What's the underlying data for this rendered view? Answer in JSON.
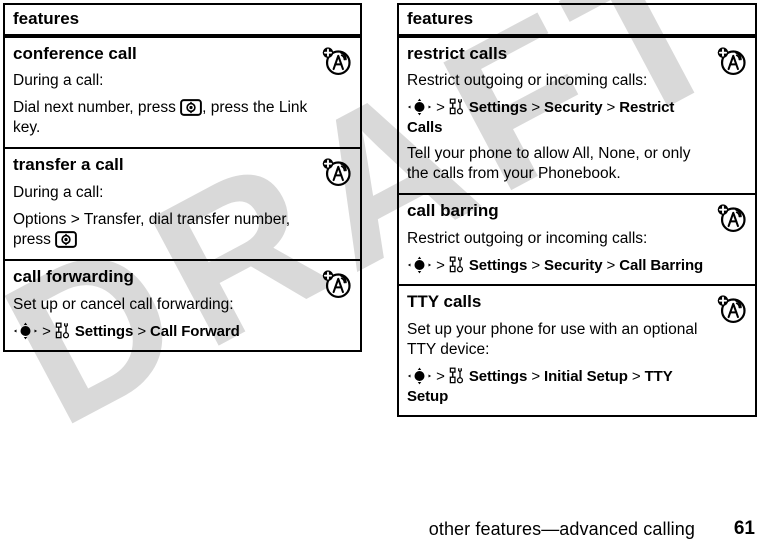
{
  "watermark": {
    "text": "DRAFT"
  },
  "footer": {
    "title": "other features—advanced calling",
    "page_number": "61"
  },
  "icons": {
    "row_badge": "tty-teletype-icon",
    "send_key": "send-key-icon",
    "nav_key": "navigation-key-icon",
    "settings_menu": "settings-tools-icon"
  },
  "colors": {
    "ink": "#000000",
    "paper": "#ffffff",
    "watermark": "#d9d9d9"
  },
  "left_table": {
    "header": "features",
    "rows": [
      {
        "title": "conference call",
        "lines": [
          {
            "kind": "text",
            "parts": [
              {
                "t": "During a call:",
                "b": false
              }
            ]
          },
          {
            "kind": "text",
            "parts": [
              {
                "t": "Dial next number, press ",
                "b": false
              },
              {
                "t": "[send-key-icon]",
                "b": false,
                "icon": "send_key"
              },
              {
                "t": ", press the ",
                "b": false
              },
              {
                "t": "Link",
                "b": true
              },
              {
                "t": " key.",
                "b": false
              }
            ]
          }
        ]
      },
      {
        "title": "transfer a call",
        "lines": [
          {
            "kind": "text",
            "parts": [
              {
                "t": "During a call:",
                "b": false
              }
            ]
          },
          {
            "kind": "text",
            "parts": [
              {
                "t": "Options",
                "b": true
              },
              {
                "t": " > ",
                "b": false
              },
              {
                "t": "Transfer",
                "b": true
              },
              {
                "t": ", dial transfer number, press ",
                "b": false
              },
              {
                "t": "[send-key-icon]",
                "b": false,
                "icon": "send_key"
              }
            ]
          }
        ]
      },
      {
        "title": "call forwarding",
        "lines": [
          {
            "kind": "text",
            "parts": [
              {
                "t": "Set up or cancel call forwarding:",
                "b": false
              }
            ]
          },
          {
            "kind": "path",
            "parts": [
              {
                "t": "[navigation-key-icon]",
                "b": false,
                "icon": "nav_key"
              },
              {
                "t": " > ",
                "b": false,
                "sep": true
              },
              {
                "t": "[settings-tools-icon]",
                "b": false,
                "icon": "settings_menu"
              },
              {
                "t": " Settings",
                "b": true
              },
              {
                "t": " > ",
                "b": false,
                "sep": true
              },
              {
                "t": "Call Forward",
                "b": true
              }
            ]
          }
        ]
      }
    ]
  },
  "right_table": {
    "header": "features",
    "rows": [
      {
        "title": "restrict calls",
        "lines": [
          {
            "kind": "text",
            "parts": [
              {
                "t": "Restrict outgoing or incoming calls:",
                "b": false
              }
            ]
          },
          {
            "kind": "path",
            "parts": [
              {
                "t": "[navigation-key-icon]",
                "b": false,
                "icon": "nav_key"
              },
              {
                "t": " > ",
                "b": false,
                "sep": true
              },
              {
                "t": "[settings-tools-icon]",
                "b": false,
                "icon": "settings_menu"
              },
              {
                "t": " Settings",
                "b": true
              },
              {
                "t": " > ",
                "b": false,
                "sep": true
              },
              {
                "t": "Security",
                "b": true
              },
              {
                "t": " > ",
                "b": false,
                "sep": true
              },
              {
                "t": "Restrict Calls",
                "b": true
              }
            ]
          },
          {
            "kind": "text",
            "parts": [
              {
                "t": "Tell your phone to allow ",
                "b": false
              },
              {
                "t": "All",
                "b": true
              },
              {
                "t": ", ",
                "b": false
              },
              {
                "t": "None",
                "b": true
              },
              {
                "t": ", or only the calls from your ",
                "b": false
              },
              {
                "t": "Phonebook",
                "b": true
              },
              {
                "t": ".",
                "b": false
              }
            ]
          }
        ]
      },
      {
        "title": "call barring",
        "lines": [
          {
            "kind": "text",
            "parts": [
              {
                "t": "Restrict outgoing or incoming calls:",
                "b": false
              }
            ]
          },
          {
            "kind": "path",
            "parts": [
              {
                "t": "[navigation-key-icon]",
                "b": false,
                "icon": "nav_key"
              },
              {
                "t": " > ",
                "b": false,
                "sep": true
              },
              {
                "t": "[settings-tools-icon]",
                "b": false,
                "icon": "settings_menu"
              },
              {
                "t": " Settings",
                "b": true
              },
              {
                "t": " > ",
                "b": false,
                "sep": true
              },
              {
                "t": "Security",
                "b": true
              },
              {
                "t": " > ",
                "b": false,
                "sep": true
              },
              {
                "t": "Call Barring",
                "b": true
              }
            ]
          }
        ]
      },
      {
        "title": "TTY calls",
        "lines": [
          {
            "kind": "text",
            "parts": [
              {
                "t": "Set up your phone for use with an optional TTY device:",
                "b": false
              }
            ]
          },
          {
            "kind": "path",
            "parts": [
              {
                "t": "[navigation-key-icon]",
                "b": false,
                "icon": "nav_key"
              },
              {
                "t": " > ",
                "b": false,
                "sep": true
              },
              {
                "t": "[settings-tools-icon]",
                "b": false,
                "icon": "settings_menu"
              },
              {
                "t": " Settings",
                "b": true
              },
              {
                "t": " > ",
                "b": false,
                "sep": true
              },
              {
                "t": "Initial Setup",
                "b": true
              },
              {
                "t": " > ",
                "b": false,
                "sep": true
              },
              {
                "t": "TTY Setup",
                "b": true
              }
            ]
          }
        ]
      }
    ]
  }
}
